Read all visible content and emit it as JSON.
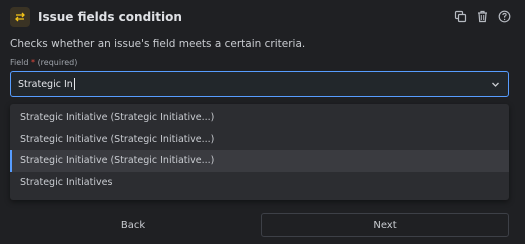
{
  "header": {
    "title": "Issue fields condition",
    "badge_icon": "swap-arrows-icon",
    "icons": [
      "duplicate-icon",
      "trash-icon",
      "help-icon"
    ]
  },
  "description": "Checks whether an issue's field meets a certain criteria.",
  "field": {
    "label": "Field",
    "required_marker": "*",
    "required_hint": "(required)",
    "value": "Strategic In"
  },
  "dropdown": {
    "options": [
      {
        "label": "Strategic Initiative (Strategic Initiative...)"
      },
      {
        "label": "Strategic Initiative (Strategic Initiative...)"
      },
      {
        "label": "Strategic Initiative (Strategic Initiative...)",
        "highlighted": true
      },
      {
        "label": "Strategic Initiatives"
      }
    ]
  },
  "footer": {
    "back_label": "Back",
    "next_label": "Next"
  },
  "colors": {
    "accent": "#579dff",
    "badge": "#f5c518",
    "required": "#e2483d"
  }
}
